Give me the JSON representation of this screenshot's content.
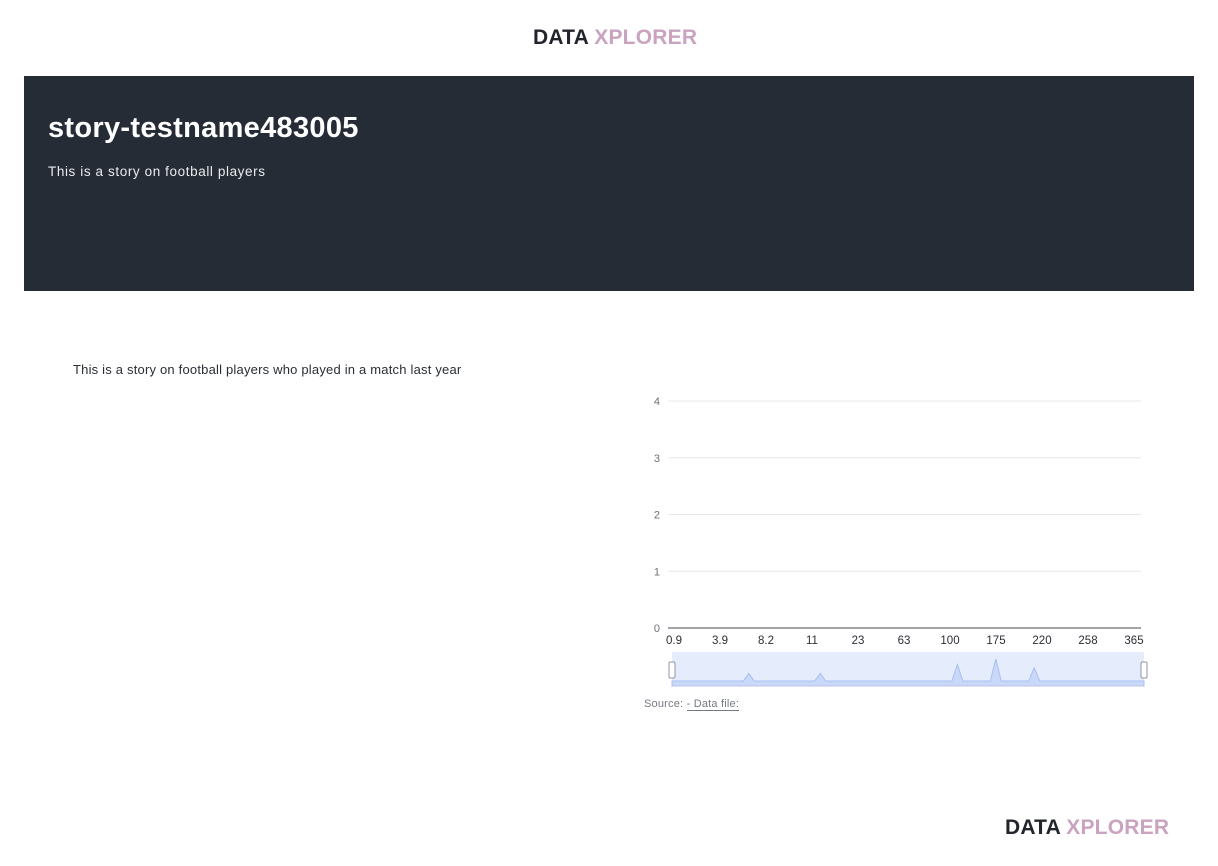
{
  "header": {
    "logo_part_a": "DATA ",
    "logo_part_b": "XPLORER"
  },
  "hero": {
    "title": "story-testname483005",
    "subtitle": "This is a story on football players"
  },
  "content": {
    "text": "This is a story on football players who played in a match last year"
  },
  "source": {
    "label": "Source:",
    "link_text": "- Data file:"
  },
  "footer": {
    "logo_part_a": "DATA ",
    "logo_part_b": "XPLORER"
  },
  "colors": {
    "hero_bg": "#262c35",
    "logo_accent": "#c9a3bf",
    "zoom_fill": "#dce6fb",
    "zoom_line": "#a8bff0"
  },
  "chart_data": {
    "type": "line",
    "title": "",
    "xlabel": "",
    "ylabel": "",
    "ylim": [
      0,
      4
    ],
    "yticks": [
      "0",
      "1",
      "2",
      "3",
      "4"
    ],
    "x_tick_labels": [
      "0.9",
      "3.9",
      "8.2",
      "11",
      "23",
      "63",
      "100",
      "175",
      "220",
      "258",
      "365"
    ],
    "grid": true,
    "series": [
      {
        "values": [
          0,
          0,
          0,
          0,
          0,
          0,
          0,
          0,
          0,
          0,
          0
        ]
      }
    ],
    "zoom_slider": {
      "range": [
        0,
        1
      ],
      "overview_profile": [
        0,
        0,
        0,
        0,
        0,
        0,
        0,
        0,
        0,
        0,
        0,
        0,
        0,
        0,
        0.35,
        0,
        0,
        0,
        0,
        0,
        0,
        0,
        0,
        0,
        0,
        0,
        0,
        0.35,
        0,
        0,
        0,
        0,
        0,
        0,
        0,
        0,
        0,
        0,
        0,
        0,
        0,
        0,
        0,
        0,
        0,
        0,
        0,
        0,
        0,
        0,
        0,
        0,
        0.75,
        0,
        0,
        0,
        0,
        0,
        0,
        1,
        0,
        0,
        0,
        0,
        0,
        0,
        0.6,
        0,
        0,
        0,
        0,
        0,
        0,
        0,
        0,
        0,
        0,
        0,
        0,
        0,
        0,
        0,
        0,
        0,
        0,
        0,
        0
      ]
    }
  }
}
